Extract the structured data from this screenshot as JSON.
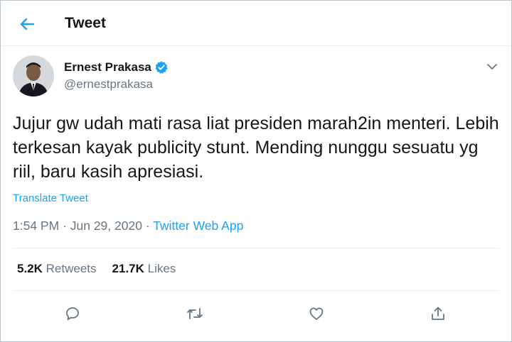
{
  "header": {
    "title": "Tweet",
    "back_icon": "arrow-left-icon"
  },
  "colors": {
    "accent": "#1da1f2",
    "secondary_text": "#657786",
    "primary_text": "#14171a",
    "divider": "#e6ecf0"
  },
  "author": {
    "display_name": "Ernest Prakasa",
    "handle": "@ernestprakasa",
    "verified": true
  },
  "tweet": {
    "text": "Jujur gw udah mati rasa liat presiden marah2in menteri. Lebih terkesan kayak publicity stunt. Mending nunggu sesuatu yg riil, baru kasih apresiasi.",
    "translate_label": "Translate Tweet",
    "time": "1:54 PM",
    "separator": " · ",
    "date": "Jun 29, 2020",
    "source": "Twitter Web App"
  },
  "stats": {
    "retweets_count": "5.2K",
    "retweets_label": "Retweets",
    "likes_count": "21.7K",
    "likes_label": "Likes"
  },
  "actions": [
    "reply-icon",
    "retweet-icon",
    "like-icon",
    "share-icon"
  ]
}
